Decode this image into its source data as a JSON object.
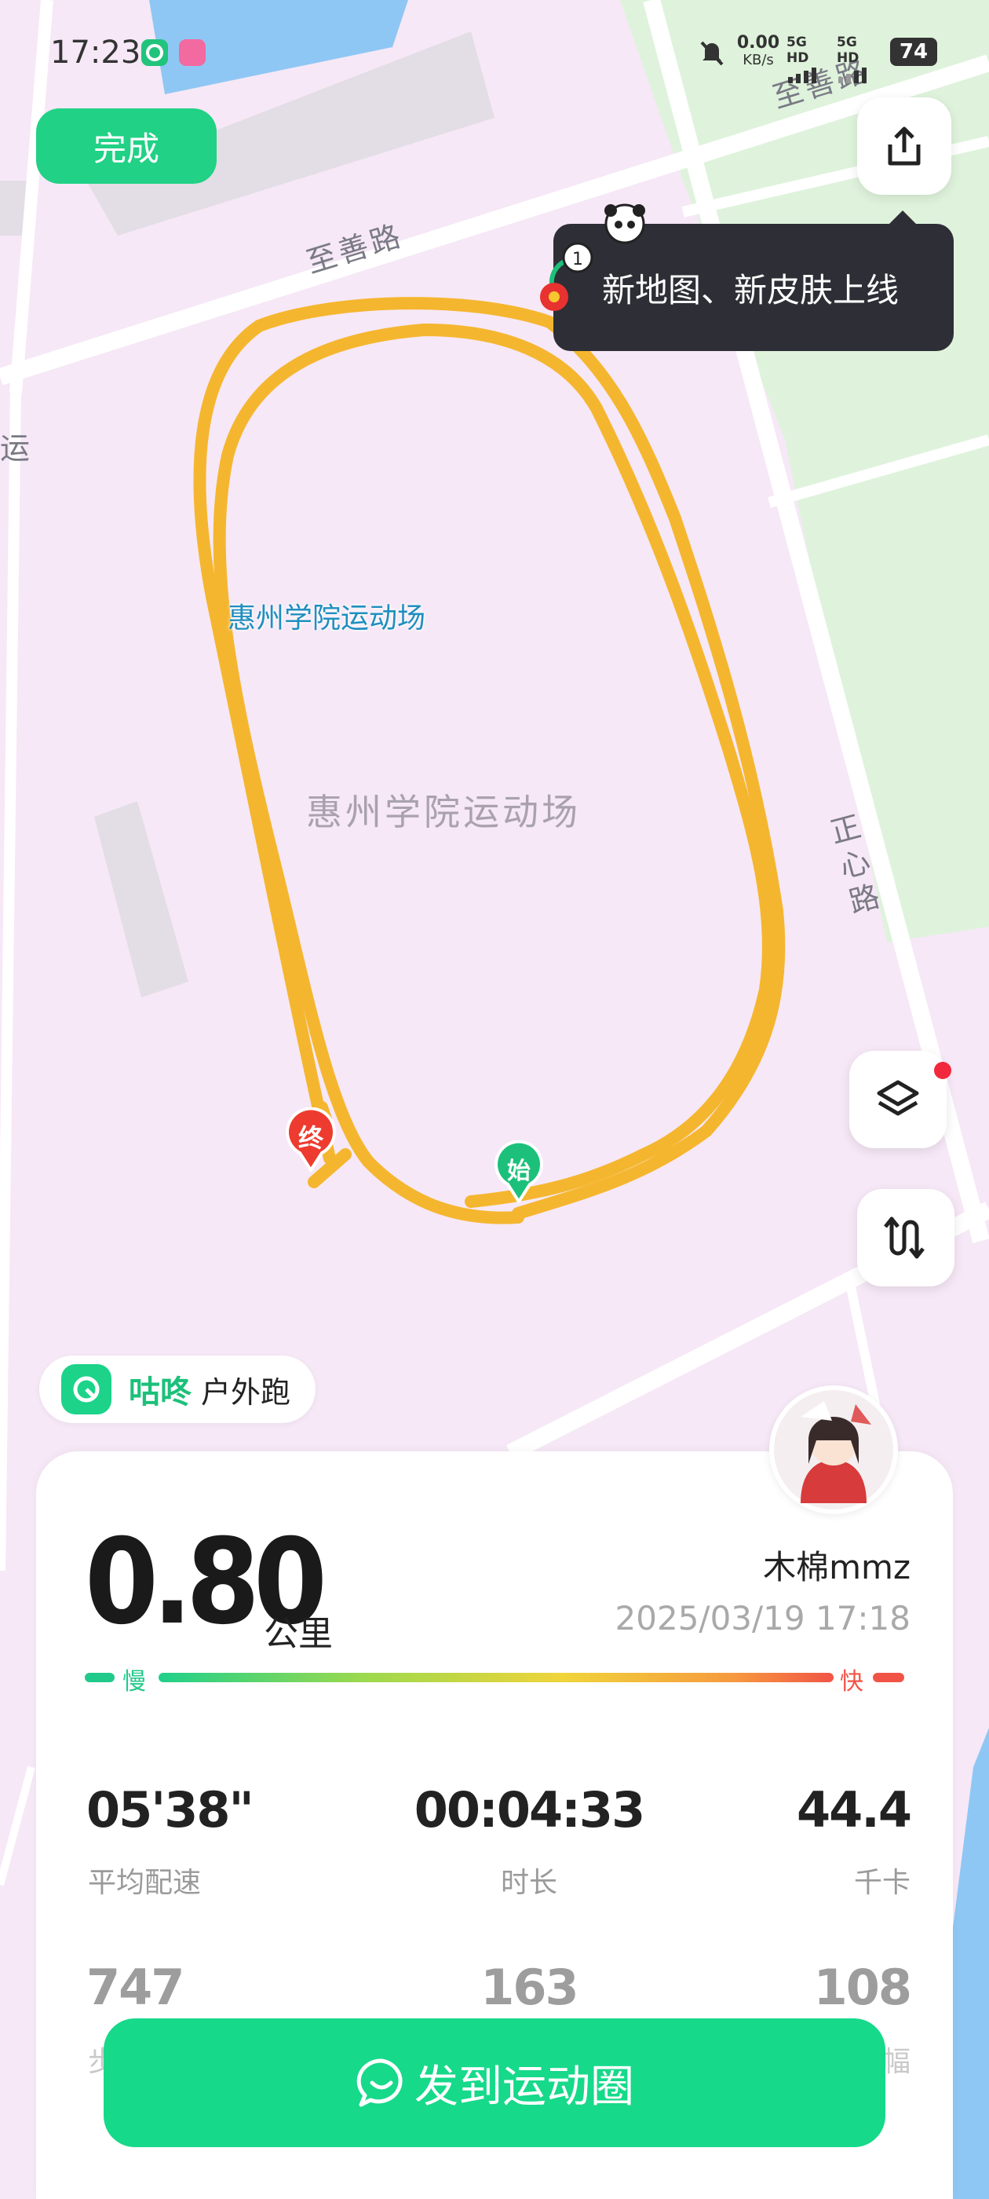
{
  "status_bar": {
    "time": "17:23",
    "net_speed": "0.00",
    "net_unit": "KB/s",
    "signal1": "5G HD",
    "signal2": "5G HD",
    "battery": "74"
  },
  "toolbar": {
    "done_label": "完成"
  },
  "tooltip": {
    "text": "新地图、新皮肤上线"
  },
  "map": {
    "roads": [
      "至善路",
      "至善路",
      "正心路",
      "运"
    ],
    "poi_label": "惠州学院运动场",
    "area_label": "惠州学院运动场",
    "start_marker": "始",
    "end_marker": "终"
  },
  "sport": {
    "brand": "咕咚",
    "type": "户外跑"
  },
  "record": {
    "distance": "0.80",
    "distance_unit": "公里",
    "username": "木棉mmz",
    "datetime": "2025/03/19 17:18",
    "pace_slow": "慢",
    "pace_fast": "快"
  },
  "stats_row1": [
    {
      "value": "05'38\"",
      "label": "平均配速"
    },
    {
      "value": "00:04:33",
      "label": "时长"
    },
    {
      "value": "44.4",
      "label": "千卡"
    }
  ],
  "stats_row2": [
    {
      "value": "747",
      "label": "步"
    },
    {
      "value": "163",
      "label": ""
    },
    {
      "value": "108",
      "label": "幅"
    }
  ],
  "actions": {
    "share_label": "发到运动圈"
  },
  "colors": {
    "accent": "#16d98a",
    "track": "#f5b62f",
    "tooltip_bg": "#2e2e36"
  }
}
